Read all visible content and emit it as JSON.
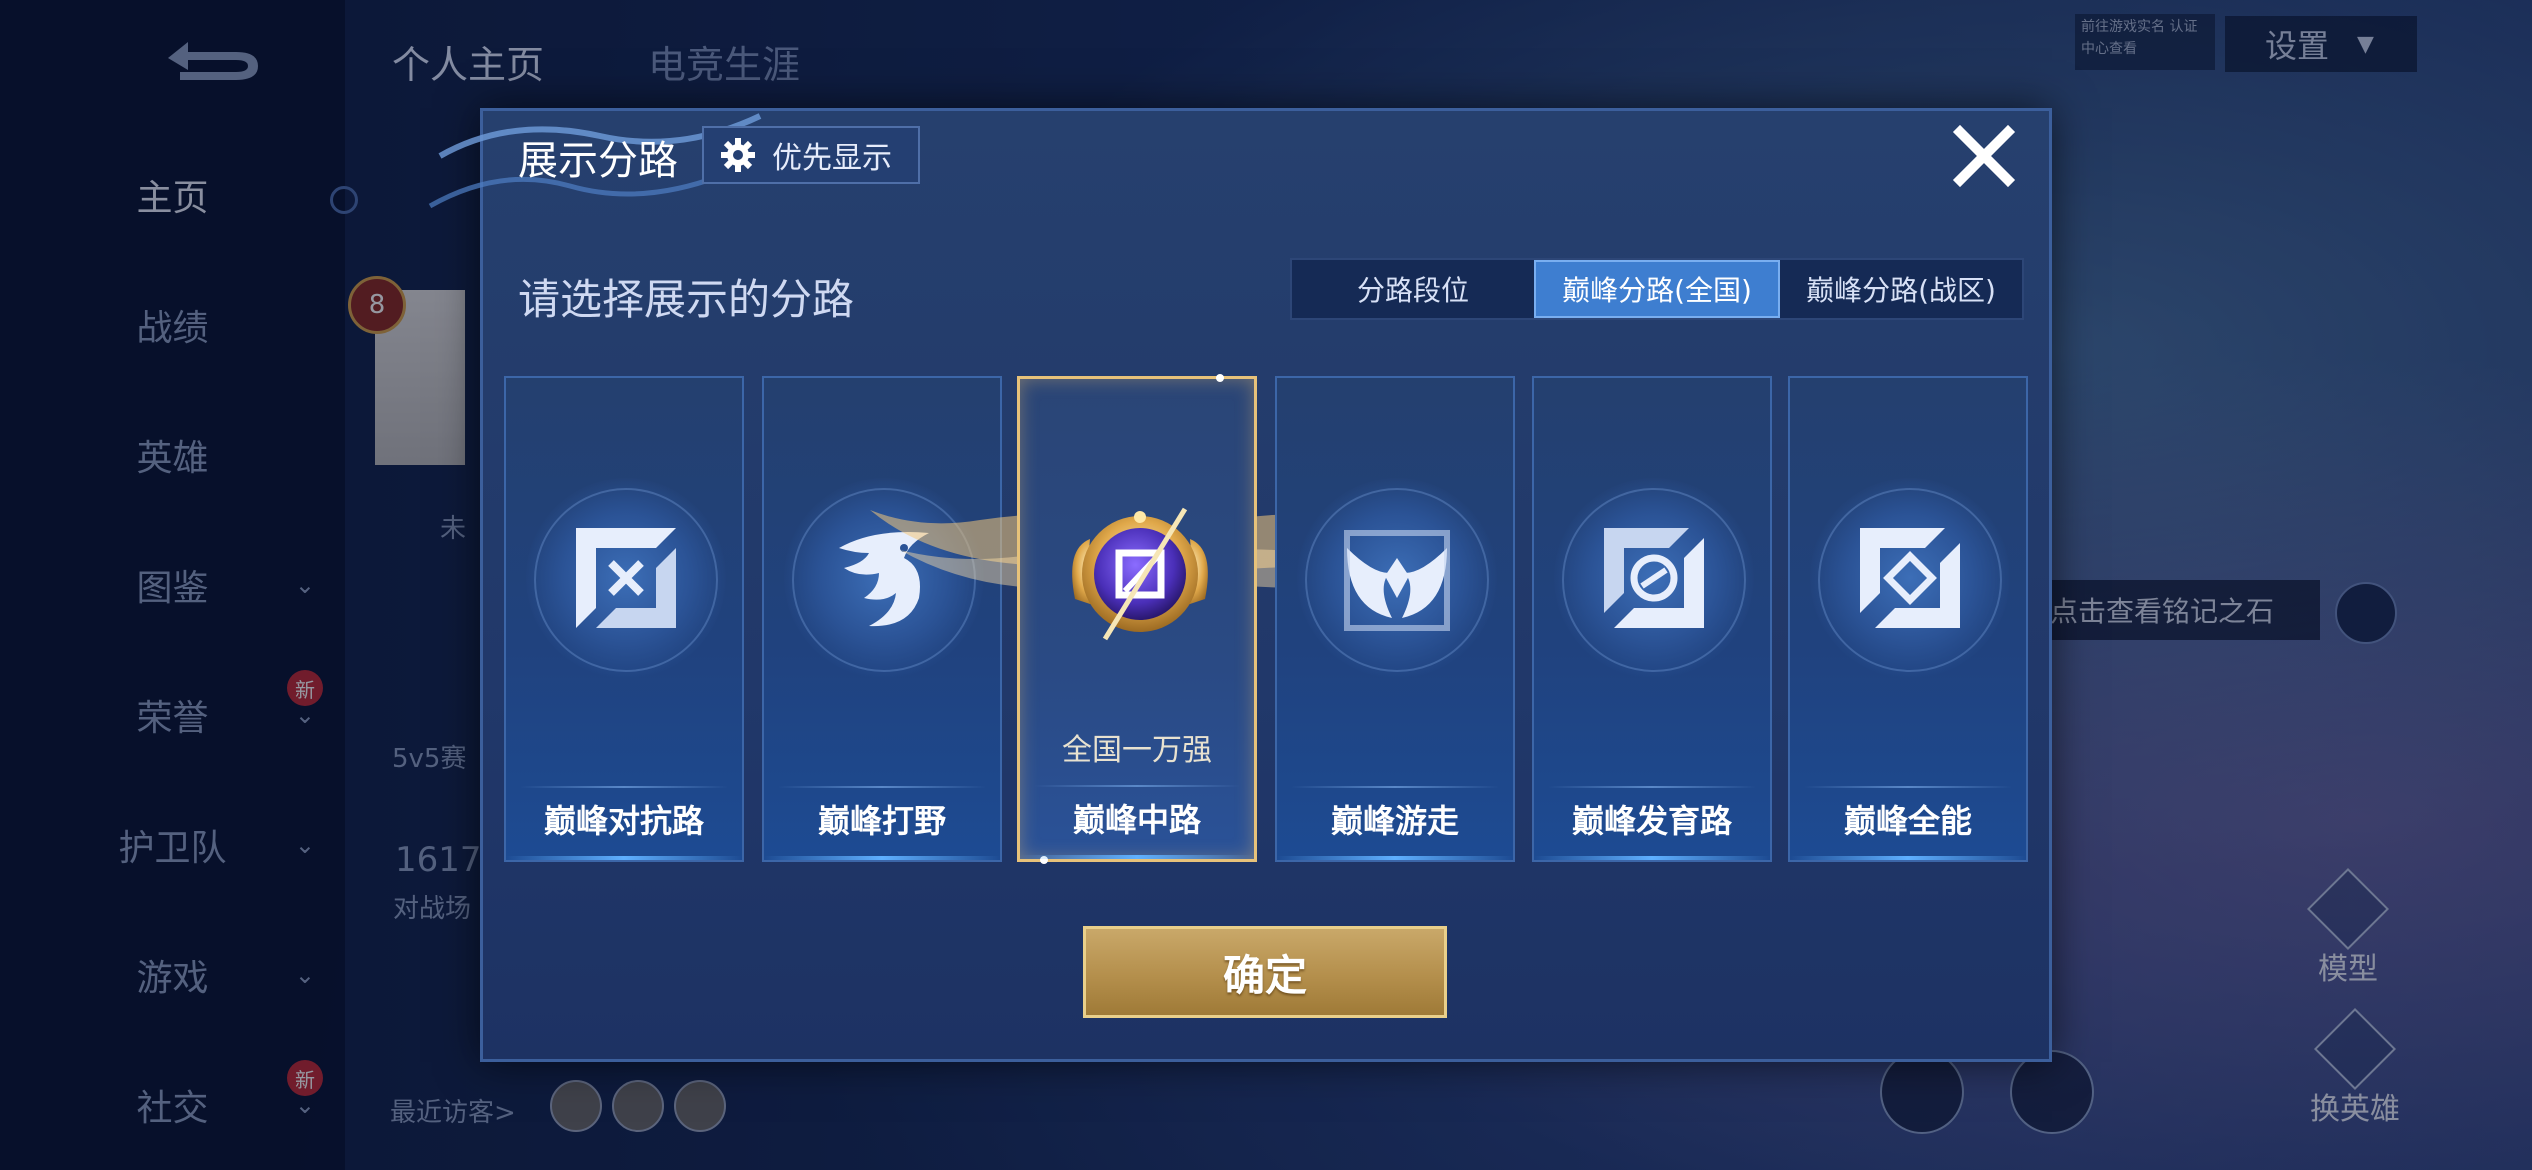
{
  "background": {
    "sidebar": {
      "items": [
        {
          "label": "主页",
          "active": true
        },
        {
          "label": "战绩"
        },
        {
          "label": "英雄"
        },
        {
          "label": "图鉴",
          "has_chevron": true
        },
        {
          "label": "荣誉",
          "has_chevron": true,
          "badge": "新"
        },
        {
          "label": "护卫队",
          "has_chevron": true
        },
        {
          "label": "游戏",
          "has_chevron": true
        },
        {
          "label": "社交",
          "has_chevron": true,
          "badge": "新"
        }
      ]
    },
    "tabs": [
      "个人主页",
      "电竞生涯"
    ],
    "settings_label": "设置",
    "realname_text": "前往游戏实名 认证中心查看",
    "level": "8",
    "status_text": "未",
    "mode_text": "5v5赛",
    "count_value": "1617",
    "count_label": "对战场",
    "inscription_hint": "点击查看铭记之石",
    "model_label": "模型",
    "change_hero_label": "换英雄",
    "visitors_label": "最近访客>",
    "visitor_count": 3
  },
  "dialog": {
    "title": "展示分路",
    "priority_button": "优先显示",
    "prompt": "请选择展示的分路",
    "segments": [
      {
        "label": "分路段位",
        "selected": false
      },
      {
        "label": "巅峰分路(全国)",
        "selected": true
      },
      {
        "label": "巅峰分路(战区)",
        "selected": false
      }
    ],
    "cards": [
      {
        "label": "巅峰对抗路",
        "icon": "clash-lane-icon",
        "selected": false
      },
      {
        "label": "巅峰打野",
        "icon": "jungle-dragon-icon",
        "selected": false
      },
      {
        "label": "巅峰中路",
        "icon": "mid-lane-emblem-icon",
        "selected": true,
        "rank_text": "全国一万强"
      },
      {
        "label": "巅峰游走",
        "icon": "roam-wings-icon",
        "selected": false
      },
      {
        "label": "巅峰发育路",
        "icon": "farm-lane-icon",
        "selected": false
      },
      {
        "label": "巅峰全能",
        "icon": "all-round-icon",
        "selected": false
      }
    ],
    "confirm_button": "确定"
  },
  "colors": {
    "accent_gold": "#e7c27a",
    "segment_active": "#3e7ed0",
    "dialog_bg": "#23396b"
  }
}
